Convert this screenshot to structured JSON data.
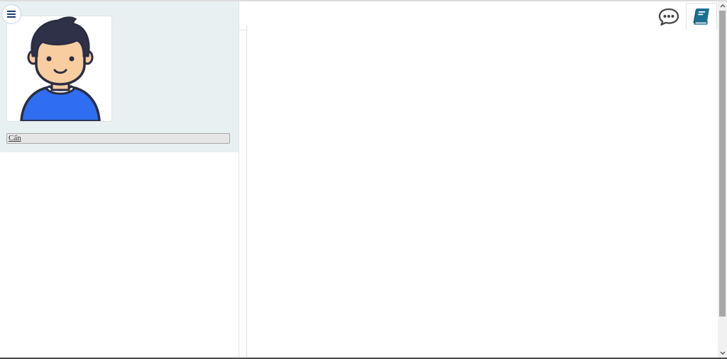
{
  "profile": {
    "name_value": "Cấn",
    "avatar_icon": "user-avatar-icon"
  },
  "toolbar": {
    "menu_icon": "hamburger-icon",
    "chat_icon": "chat-bubble-icon",
    "book_icon": "book-icon"
  },
  "colors": {
    "panel_bg": "#e9f0f2",
    "menu_icon": "#1f3b70",
    "chat_icon": "#444444",
    "book_icon": "#1b6f93",
    "avatar_shirt": "#2f6ef0",
    "avatar_skin": "#f8cda0",
    "avatar_hair": "#2f3148"
  }
}
